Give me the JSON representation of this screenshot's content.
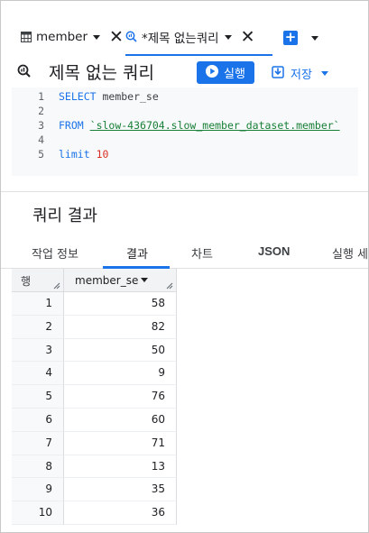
{
  "tabs": [
    {
      "label": "member",
      "icon": "table-icon"
    },
    {
      "label": "*제목 없는쿼리",
      "icon": "query-icon"
    }
  ],
  "query": {
    "title": "제목 없는 쿼리",
    "run_label": "실행",
    "save_label": "저장"
  },
  "editor": {
    "line_numbers": [
      "1",
      "2",
      "3",
      "4",
      "5"
    ],
    "line1": {
      "kw": "SELECT",
      "rest": " member_se"
    },
    "line3": {
      "kw": "FROM",
      "table": "`slow-436704.slow_member_dataset.member`"
    },
    "line5": {
      "kw": "limit",
      "num": "10"
    }
  },
  "results": {
    "title": "쿼리 결과",
    "tabs": [
      "작업 정보",
      "결과",
      "차트",
      "JSON",
      "실행 세"
    ],
    "active_tab": "결과",
    "columns": {
      "row": "행",
      "col1": "member_se"
    },
    "rows": [
      {
        "n": "1",
        "v": "58"
      },
      {
        "n": "2",
        "v": "82"
      },
      {
        "n": "3",
        "v": "50"
      },
      {
        "n": "4",
        "v": "9"
      },
      {
        "n": "5",
        "v": "76"
      },
      {
        "n": "6",
        "v": "60"
      },
      {
        "n": "7",
        "v": "71"
      },
      {
        "n": "8",
        "v": "13"
      },
      {
        "n": "9",
        "v": "35"
      },
      {
        "n": "10",
        "v": "36"
      }
    ]
  },
  "colors": {
    "accent": "#1a73e8",
    "table_ref": "#188038",
    "number": "#d93025"
  }
}
